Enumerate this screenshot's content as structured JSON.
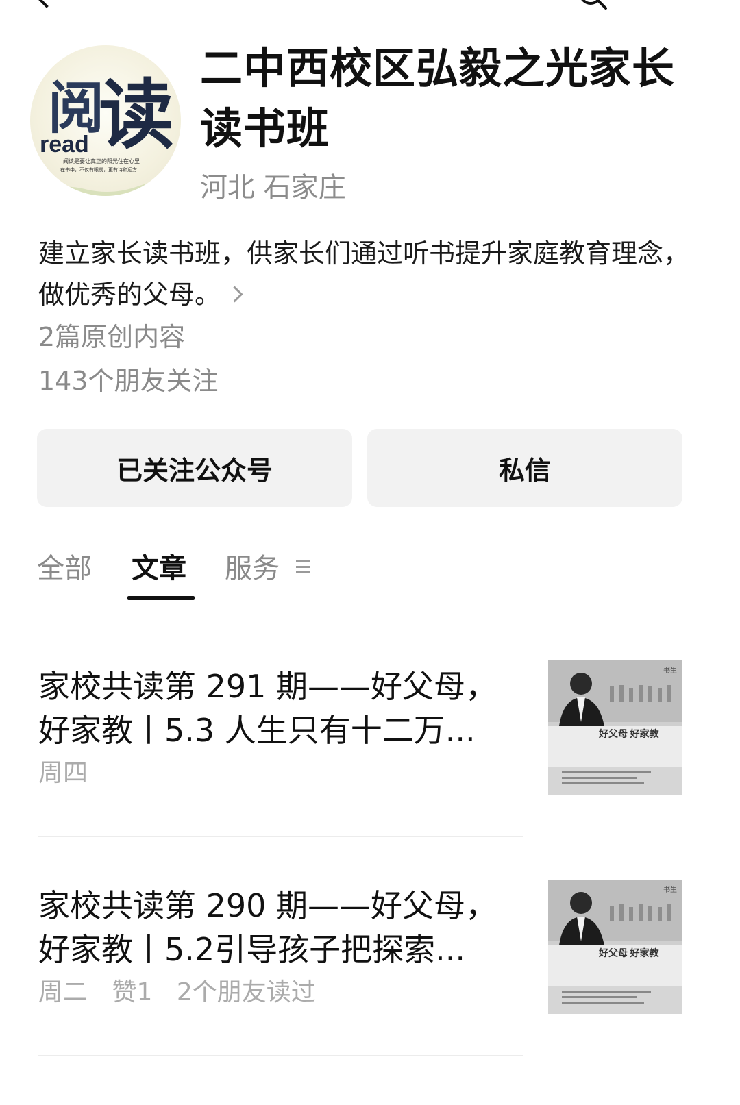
{
  "account": {
    "name": "二中西校区弘毅之光家长读书班",
    "location": "河北 石家庄",
    "description": "建立家长读书班，供家长们通过听书提升家庭教育理念，做优秀的父母。",
    "original_count": "2篇原创内容",
    "followers": "143个朋友关注"
  },
  "avatar": {
    "big_text_1": "阅",
    "big_text_2": "读",
    "latin_text": "read",
    "caption_1": "阅读是要让真正的阳光住在心里",
    "caption_2": "在书中，不仅有眼前，更有诗和远方"
  },
  "buttons": {
    "follow_label": "已关注公众号",
    "message_label": "私信"
  },
  "tabs": [
    {
      "label": "全部",
      "active": false
    },
    {
      "label": "文章",
      "active": true
    },
    {
      "label": "服务",
      "active": false
    }
  ],
  "articles": [
    {
      "title": "家校共读第 291 期——好父母，好家教丨5.3 人生只有十二万...",
      "meta": [
        "周四"
      ],
      "cover": {
        "title": "好父母 好家教",
        "author": "书生"
      }
    },
    {
      "title": "家校共读第 290 期——好父母，好家教丨5.2引导孩子把探索...",
      "meta": [
        "周二",
        "赞1",
        "2个朋友读过"
      ],
      "cover": {
        "title": "好父母 好家教",
        "author": "书生"
      }
    }
  ],
  "icons": {
    "back": "back-arrow-icon",
    "search": "search-icon",
    "description_more": "chevron-right-icon",
    "service_menu": "menu-icon"
  }
}
